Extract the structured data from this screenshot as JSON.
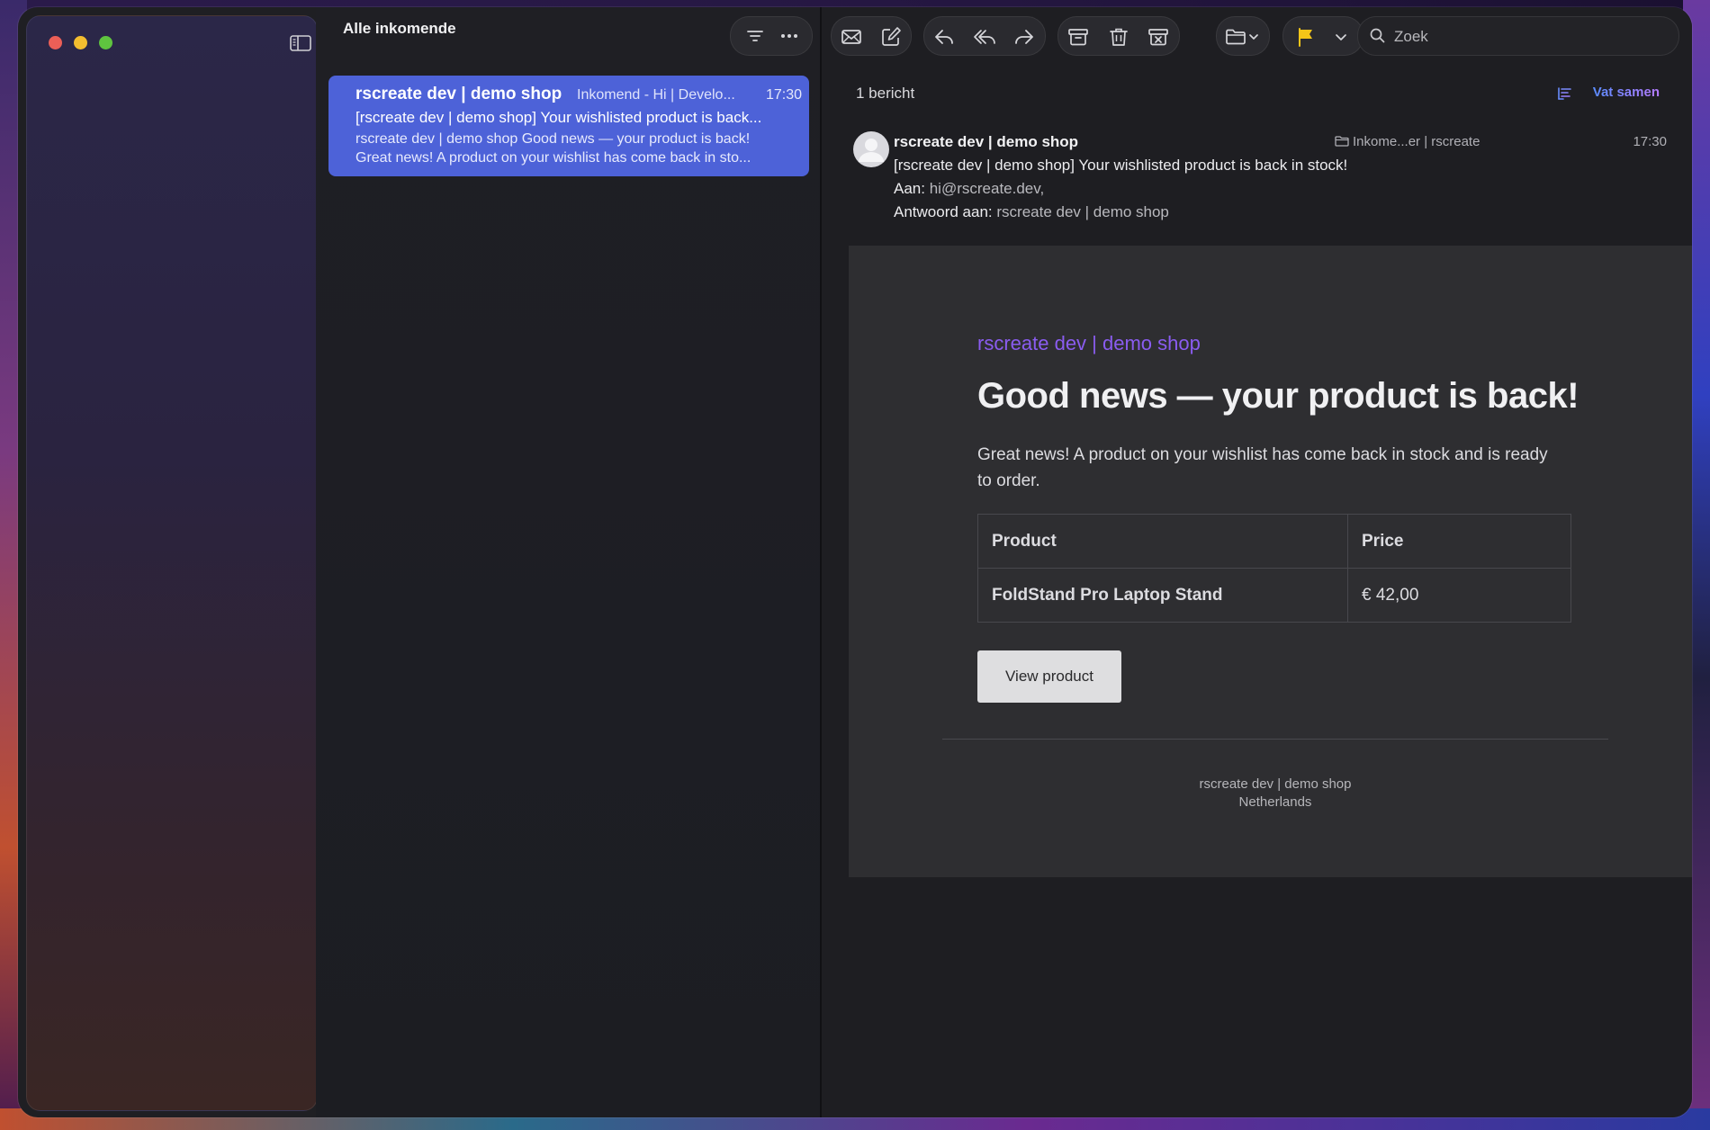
{
  "window": {
    "list_title": "Alle inkomende",
    "search_placeholder": "Zoek"
  },
  "message_list": {
    "items": [
      {
        "sender": "rscreate dev | demo shop",
        "folder": "Inkomend - Hi | Develo...",
        "time": "17:30",
        "subject": "[rscreate dev | demo shop] Your wishlisted product is back...",
        "preview_1": "rscreate dev | demo shop Good news — your product is back!",
        "preview_2": "Great news! A product on your wishlist has come back in sto..."
      }
    ]
  },
  "reader": {
    "count": "1 bericht",
    "summarize_label": "Vat samen",
    "header": {
      "sender": "rscreate dev | demo shop",
      "subject": "[rscreate dev | demo shop] Your wishlisted product is back in stock!",
      "to_label": "Aan:",
      "to_value": "hi@rscreate.dev,",
      "reply_label": "Antwoord aan:",
      "reply_value": "rscreate dev | demo shop",
      "folder": "Inkome...er | rscreate",
      "time": "17:30"
    },
    "email": {
      "shop_name": "rscreate dev | demo shop",
      "headline": "Good news — your product is back!",
      "lead": "Great news! A product on your wishlist has come back in stock and is ready to order.",
      "table_headers": [
        "Product",
        "Price"
      ],
      "table_rows": [
        {
          "product": "FoldStand Pro Laptop Stand",
          "price": "€ 42,00"
        }
      ],
      "button_label": "View product",
      "footer_line1": "rscreate dev | demo shop",
      "footer_line2": "Netherlands"
    }
  },
  "colors": {
    "selected_row": "#4d62d8",
    "accent_purple": "#8a5cf0",
    "flag": "#f5c518"
  }
}
